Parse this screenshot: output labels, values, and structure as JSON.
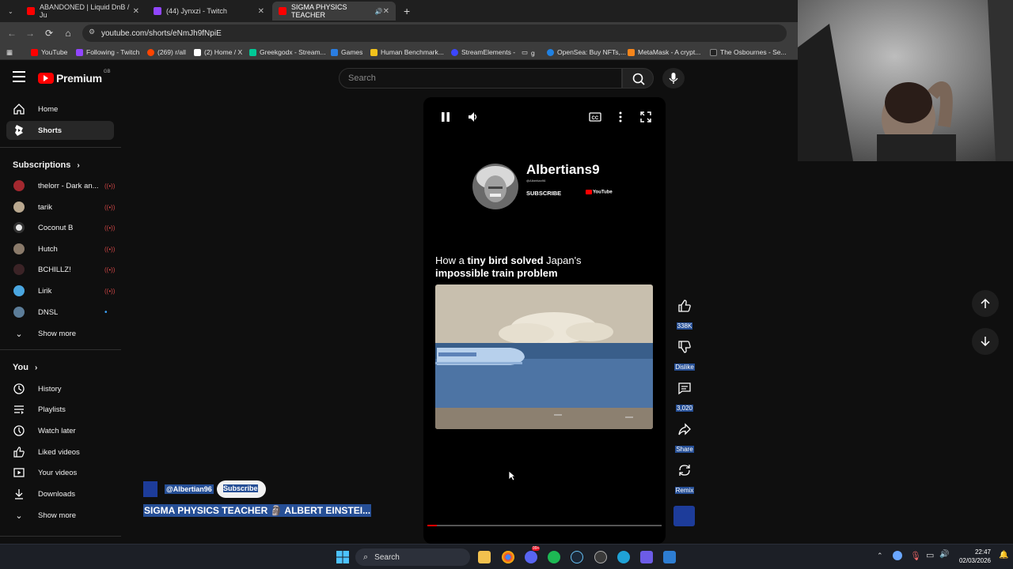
{
  "browser": {
    "tabs": [
      {
        "label": "ABANDONED | Liquid DnB / Ju",
        "color": "#ff0000"
      },
      {
        "label": "(44) Jynxzi - Twitch",
        "color": "#9146ff"
      },
      {
        "label": "SIGMA PHYSICS TEACHER",
        "color": "#ff0000"
      }
    ],
    "url": "youtube.com/shorts/eNmJh9fNpiE",
    "bookmarks": [
      {
        "label": "YouTube",
        "color": "#ff0000"
      },
      {
        "label": "Following - Twitch",
        "color": "#9146ff"
      },
      {
        "label": "(269) r/all",
        "color": "#ff4500"
      },
      {
        "label": "(2) Home / X",
        "color": "#ffffff"
      },
      {
        "label": "Greekgodx - Stream...",
        "color": "#00c896"
      },
      {
        "label": "Games",
        "color": "#2a7de1"
      },
      {
        "label": "Human Benchmark...",
        "color": "#f2c21b"
      },
      {
        "label": "StreamElements -",
        "color": "#3c46ff"
      },
      {
        "label": "g",
        "color": "#aaaaaa"
      },
      {
        "label": "OpenSea: Buy NFTs,...",
        "color": "#2081e2"
      },
      {
        "label": "MetaMask - A crypt...",
        "color": "#f6851b"
      },
      {
        "label": "The Osbournes - Se...",
        "color": "#222222"
      }
    ]
  },
  "yt": {
    "logo": "Premium",
    "region": "GB",
    "search_placeholder": "Search"
  },
  "sidebar": {
    "home": "Home",
    "shorts": "Shorts",
    "subscriptions_title": "Subscriptions",
    "subscriptions": [
      {
        "label": "thelorr - Dark an...",
        "color": "#a3282f",
        "live": true
      },
      {
        "label": "tarik",
        "color": "#b9a88f",
        "live": true
      },
      {
        "label": "Coconut B",
        "color": "#e8e8e8",
        "live": true
      },
      {
        "label": "Hutch",
        "color": "#8a7a6a",
        "live": true
      },
      {
        "label": "BCHILLZ!",
        "color": "#3b2326",
        "live": true
      },
      {
        "label": "Lirik",
        "color": "#4aa6e0",
        "live": true
      },
      {
        "label": "DNSL",
        "color": "#5c7d99",
        "live": false
      }
    ],
    "show_more": "Show more",
    "you_title": "You",
    "you_items": [
      {
        "label": "History",
        "icon": "history-icon"
      },
      {
        "label": "Playlists",
        "icon": "playlists-icon"
      },
      {
        "label": "Watch later",
        "icon": "watch-later-icon"
      },
      {
        "label": "Liked videos",
        "icon": "liked-videos-icon"
      },
      {
        "label": "Your videos",
        "icon": "your-videos-icon"
      },
      {
        "label": "Downloads",
        "icon": "downloads-icon"
      }
    ],
    "show_more_2": "Show more"
  },
  "player": {
    "channel": "Albertians9",
    "handle": "@Albertian96",
    "subscribe": "SUBSCRIBE",
    "yt_label": "YouTube",
    "headline_parts": [
      "How a ",
      "tiny bird solved",
      " Japan's",
      "impossible train problem"
    ],
    "progress": 0.04
  },
  "actions": {
    "likes": "338K",
    "dislike": "Dislike",
    "comments": "3,020",
    "share": "Share",
    "remix": "Remix"
  },
  "overlay": {
    "channel_handle": "@Albertian96",
    "subscribe_btn": "Subscribe",
    "title": "SIGMA PHYSICS TEACHER 🗿 ALBERT EINSTEI..."
  },
  "taskbar": {
    "search": "Search",
    "time": "22:47",
    "date": "02/03/2026",
    "badge": "99+"
  }
}
